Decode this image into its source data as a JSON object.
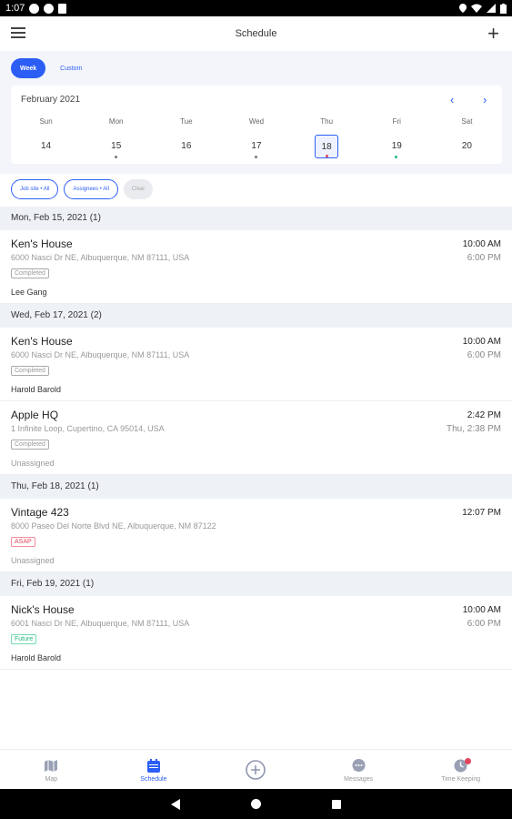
{
  "status_bar": {
    "time": "1:07"
  },
  "app_bar": {
    "title": "Schedule"
  },
  "view_toggle": {
    "week_label": "Week",
    "custom_label": "Custom"
  },
  "calendar": {
    "month": "February 2021",
    "days": [
      {
        "dow": "Sun",
        "num": "14",
        "marker": ""
      },
      {
        "dow": "Mon",
        "num": "15",
        "marker": "#777777"
      },
      {
        "dow": "Tue",
        "num": "16",
        "marker": ""
      },
      {
        "dow": "Wed",
        "num": "17",
        "marker": "#777777"
      },
      {
        "dow": "Thu",
        "num": "18",
        "marker": "#e2445c"
      },
      {
        "dow": "Fri",
        "num": "19",
        "marker": "#1fb77a"
      },
      {
        "dow": "Sat",
        "num": "20",
        "marker": ""
      }
    ],
    "selected_day": "18"
  },
  "filters": {
    "job_site": "Job site • All",
    "assignees": "Assignees • All",
    "clear": "Clear"
  },
  "sections": [
    {
      "header": "Mon, Feb 15, 2021 (1)",
      "jobs": [
        {
          "name": "Ken's House",
          "address": "6000 Nasci Dr NE, Albuquerque, NM 87111, USA",
          "status": "Completed",
          "assignee": "Lee Gang",
          "time_start": "10:00 AM",
          "time_end": "6:00 PM"
        }
      ]
    },
    {
      "header": "Wed, Feb 17, 2021 (2)",
      "jobs": [
        {
          "name": "Ken's House",
          "address": "6000 Nasci Dr NE, Albuquerque, NM 87111, USA",
          "status": "Completed",
          "assignee": "Harold Barold",
          "time_start": "10:00 AM",
          "time_end": "6:00 PM"
        },
        {
          "name": "Apple HQ",
          "address": "1 Infinite Loop, Cupertino, CA 95014, USA",
          "status": "Completed",
          "assignee": "Unassigned",
          "time_start": "2:42 PM",
          "time_end": "Thu, 2:38 PM"
        }
      ]
    },
    {
      "header": "Thu, Feb 18, 2021 (1)",
      "jobs": [
        {
          "name": "Vintage 423",
          "address": "8000 Paseo Del Norte Blvd NE, Albuquerque, NM 87122",
          "status": "ASAP",
          "assignee": "Unassigned",
          "time_start": "12:07 PM",
          "time_end": ""
        }
      ]
    },
    {
      "header": "Fri, Feb 19, 2021 (1)",
      "jobs": [
        {
          "name": "Nick's House",
          "address": "6001 Nasci Dr NE, Albuquerque, NM 87111, USA",
          "status": "Future",
          "assignee": "Harold Barold",
          "time_start": "10:00 AM",
          "time_end": "6:00 PM"
        }
      ]
    }
  ],
  "bottom_nav": [
    {
      "label": "Map",
      "icon": "map-icon"
    },
    {
      "label": "Schedule",
      "icon": "calendar-icon"
    },
    {
      "label": "",
      "icon": "add-circle-icon"
    },
    {
      "label": "Messages",
      "icon": "chat-icon"
    },
    {
      "label": "Time Keeping",
      "icon": "clock-icon"
    }
  ],
  "colors": {
    "accent": "#2c5ef5",
    "asap": "#e2445c",
    "future": "#1fb77a",
    "completed": "#999999"
  }
}
